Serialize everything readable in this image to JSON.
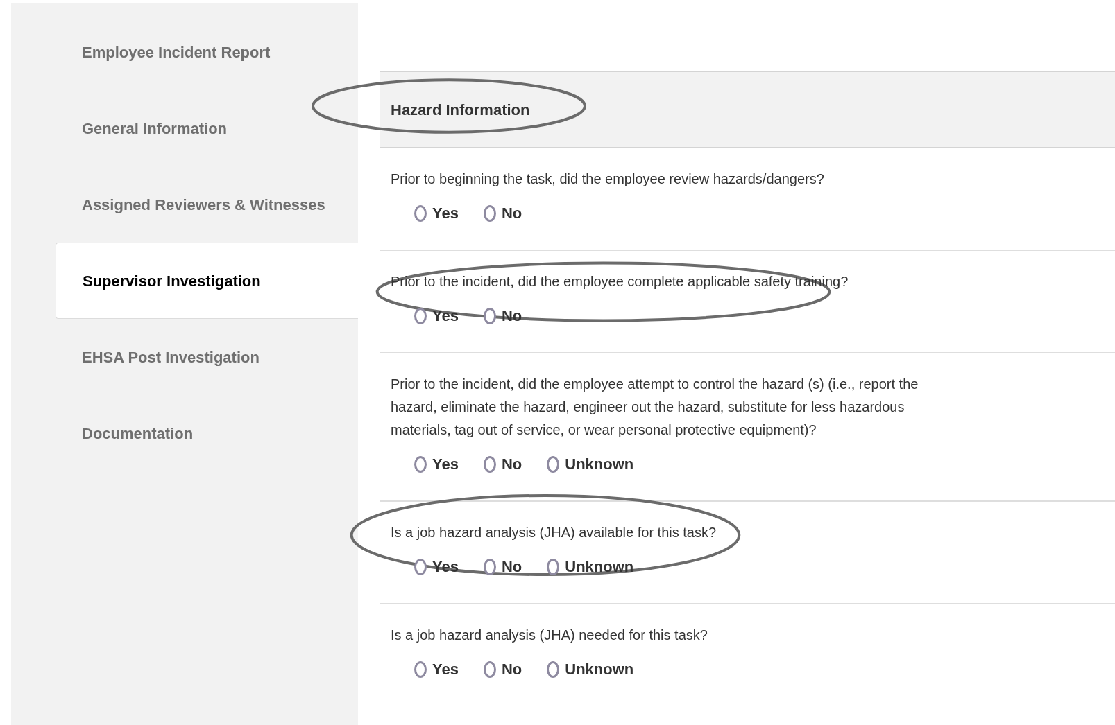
{
  "sidebar": {
    "items": [
      {
        "label": "Employee Incident Report",
        "selected": false
      },
      {
        "label": "General Information",
        "selected": false
      },
      {
        "label": "Assigned Reviewers & Witnesses",
        "selected": false
      },
      {
        "label": "Supervisor Investigation",
        "selected": true
      },
      {
        "label": "EHSA Post Investigation",
        "selected": false
      },
      {
        "label": "Documentation",
        "selected": false
      }
    ]
  },
  "section": {
    "title": "Hazard Information",
    "circled": true
  },
  "questions": [
    {
      "text": "Prior to beginning the task, did the employee review hazards/dangers?",
      "circled": false,
      "options": [
        {
          "label": "Yes",
          "selected": false
        },
        {
          "label": "No",
          "selected": false
        }
      ]
    },
    {
      "text": "Prior to the incident, did the employee complete applicable safety training?",
      "circled": true,
      "options": [
        {
          "label": "Yes",
          "selected": false
        },
        {
          "label": "No",
          "selected": false
        }
      ]
    },
    {
      "text": "Prior to the incident, did the employee attempt to control the hazard (s) (i.e., report the hazard, eliminate the hazard, engineer out the hazard, substitute for less hazardous materials, tag out of service, or wear personal protective equipment)?",
      "circled": false,
      "options": [
        {
          "label": "Yes",
          "selected": false
        },
        {
          "label": "No",
          "selected": false
        },
        {
          "label": "Unknown",
          "selected": false
        }
      ]
    },
    {
      "text": "Is a job hazard analysis (JHA) available for this task?",
      "circled": true,
      "options": [
        {
          "label": "Yes",
          "selected": false
        },
        {
          "label": "No",
          "selected": false
        },
        {
          "label": "Unknown",
          "selected": false
        }
      ]
    },
    {
      "text": "Is a job hazard analysis (JHA) needed for this task?",
      "circled": false,
      "options": [
        {
          "label": "Yes",
          "selected": false
        },
        {
          "label": "No",
          "selected": false
        },
        {
          "label": "Unknown",
          "selected": false
        }
      ]
    }
  ]
}
